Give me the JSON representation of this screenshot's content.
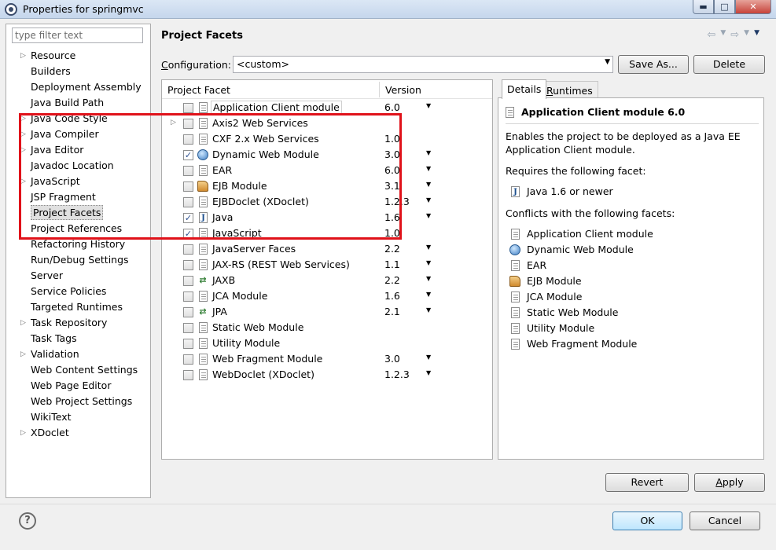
{
  "window": {
    "title": "Properties for springmvc"
  },
  "filter": {
    "placeholder": "type filter text"
  },
  "nav": {
    "items": [
      {
        "label": "Resource",
        "expandable": true
      },
      {
        "label": "Builders",
        "expandable": false
      },
      {
        "label": "Deployment Assembly",
        "expandable": false
      },
      {
        "label": "Java Build Path",
        "expandable": false
      },
      {
        "label": "Java Code Style",
        "expandable": true
      },
      {
        "label": "Java Compiler",
        "expandable": true
      },
      {
        "label": "Java Editor",
        "expandable": true
      },
      {
        "label": "Javadoc Location",
        "expandable": false
      },
      {
        "label": "JavaScript",
        "expandable": true
      },
      {
        "label": "JSP Fragment",
        "expandable": false
      },
      {
        "label": "Project Facets",
        "expandable": false,
        "selected": true
      },
      {
        "label": "Project References",
        "expandable": false
      },
      {
        "label": "Refactoring History",
        "expandable": false
      },
      {
        "label": "Run/Debug Settings",
        "expandable": false
      },
      {
        "label": "Server",
        "expandable": false
      },
      {
        "label": "Service Policies",
        "expandable": false
      },
      {
        "label": "Targeted Runtimes",
        "expandable": false
      },
      {
        "label": "Task Repository",
        "expandable": true
      },
      {
        "label": "Task Tags",
        "expandable": false
      },
      {
        "label": "Validation",
        "expandable": true
      },
      {
        "label": "Web Content Settings",
        "expandable": false
      },
      {
        "label": "Web Page Editor",
        "expandable": false
      },
      {
        "label": "Web Project Settings",
        "expandable": false
      },
      {
        "label": "WikiText",
        "expandable": false
      },
      {
        "label": "XDoclet",
        "expandable": true
      }
    ]
  },
  "page": {
    "title": "Project Facets"
  },
  "config": {
    "label_prefix": "C",
    "label_rest": "onfiguration:",
    "value": "<custom>",
    "save_as": "Save As...",
    "delete": "Delete"
  },
  "facets": {
    "col_facet": "Project Facet",
    "col_version": "Version",
    "rows": [
      {
        "name": "Application Client module",
        "version": "6.0",
        "checked": false,
        "icon": "doc",
        "dropdown": true,
        "boxed": true
      },
      {
        "name": "Axis2 Web Services",
        "version": "",
        "checked": false,
        "icon": "doc",
        "dropdown": false,
        "expander": true
      },
      {
        "name": "CXF 2.x Web Services",
        "version": "1.0",
        "checked": false,
        "icon": "doc",
        "dropdown": false
      },
      {
        "name": "Dynamic Web Module",
        "version": "3.0",
        "checked": true,
        "icon": "globe",
        "dropdown": true
      },
      {
        "name": "EAR",
        "version": "6.0",
        "checked": false,
        "icon": "doc",
        "dropdown": true
      },
      {
        "name": "EJB Module",
        "version": "3.1",
        "checked": false,
        "icon": "bean",
        "dropdown": true
      },
      {
        "name": "EJBDoclet (XDoclet)",
        "version": "1.2.3",
        "checked": false,
        "icon": "doc",
        "dropdown": true
      },
      {
        "name": "Java",
        "version": "1.6",
        "checked": true,
        "icon": "j",
        "dropdown": true
      },
      {
        "name": "JavaScript",
        "version": "1.0",
        "checked": true,
        "icon": "doc",
        "dropdown": false
      },
      {
        "name": "JavaServer Faces",
        "version": "2.2",
        "checked": false,
        "icon": "doc",
        "dropdown": true
      },
      {
        "name": "JAX-RS (REST Web Services)",
        "version": "1.1",
        "checked": false,
        "icon": "doc",
        "dropdown": true
      },
      {
        "name": "JAXB",
        "version": "2.2",
        "checked": false,
        "icon": "arrows",
        "dropdown": true
      },
      {
        "name": "JCA Module",
        "version": "1.6",
        "checked": false,
        "icon": "doc",
        "dropdown": true
      },
      {
        "name": "JPA",
        "version": "2.1",
        "checked": false,
        "icon": "arrows",
        "dropdown": true
      },
      {
        "name": "Static Web Module",
        "version": "",
        "checked": false,
        "icon": "doc",
        "dropdown": false
      },
      {
        "name": "Utility Module",
        "version": "",
        "checked": false,
        "icon": "doc",
        "dropdown": false
      },
      {
        "name": "Web Fragment Module",
        "version": "3.0",
        "checked": false,
        "icon": "doc",
        "dropdown": true
      },
      {
        "name": "WebDoclet (XDoclet)",
        "version": "1.2.3",
        "checked": false,
        "icon": "doc",
        "dropdown": true
      }
    ]
  },
  "tabs": {
    "details": "Details",
    "runtimes_prefix": "R",
    "runtimes_rest": "untimes"
  },
  "details": {
    "title": "Application Client module 6.0",
    "description": "Enables the project to be deployed as a Java EE Application Client module.",
    "requires_label": "Requires the following facet:",
    "requires": [
      {
        "name": "Java 1.6 or newer",
        "icon": "j"
      }
    ],
    "conflicts_label": "Conflicts with the following facets:",
    "conflicts": [
      {
        "name": "Application Client module",
        "icon": "doc"
      },
      {
        "name": "Dynamic Web Module",
        "icon": "globe"
      },
      {
        "name": "EAR",
        "icon": "doc"
      },
      {
        "name": "EJB Module",
        "icon": "bean"
      },
      {
        "name": "JCA Module",
        "icon": "doc"
      },
      {
        "name": "Static Web Module",
        "icon": "doc"
      },
      {
        "name": "Utility Module",
        "icon": "doc"
      },
      {
        "name": "Web Fragment Module",
        "icon": "doc"
      }
    ]
  },
  "buttons": {
    "revert": "Revert",
    "apply": "Apply",
    "ok": "OK",
    "cancel": "Cancel"
  },
  "colors": {
    "highlight": "#e0121a",
    "selection": "#e0e0e0"
  }
}
